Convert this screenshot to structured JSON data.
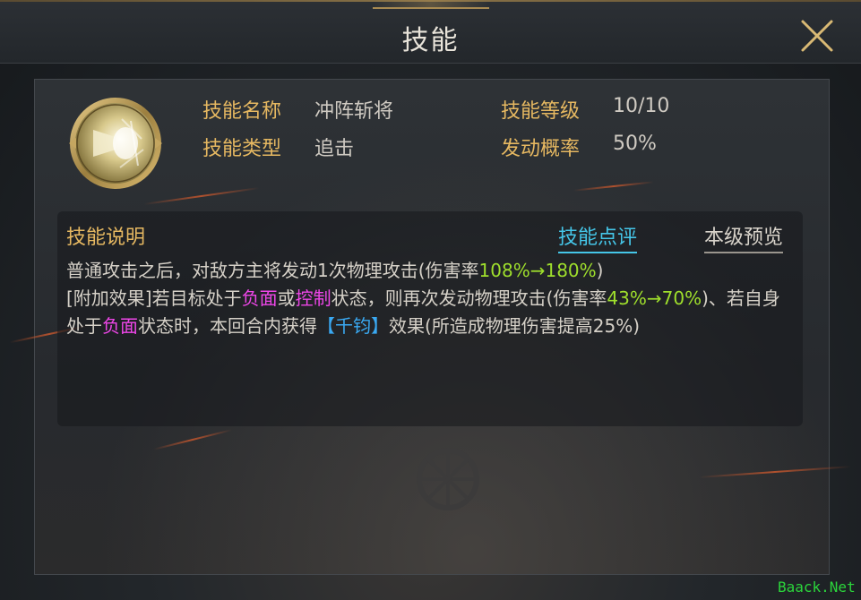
{
  "header": {
    "title": "技能",
    "close_icon": "close-x-icon"
  },
  "skill_info": {
    "icon": "skill-emblem-icon",
    "name_label": "技能名称",
    "name_value": "冲阵斩将",
    "level_label": "技能等级",
    "level_value": "10/10",
    "type_label": "技能类型",
    "type_value": "追击",
    "chance_label": "发动概率",
    "chance_value": "50%"
  },
  "description": {
    "header": "技能说明",
    "tab_review": "技能点评",
    "tab_preview": "本级预览",
    "line1_a": "普通攻击之后，对敌方主将发动1次物理攻击(伤害率",
    "line1_b": "108%→180%",
    "line1_c": ")",
    "line2_a": "[附加效果]若目标处于",
    "line2_b": "负面",
    "line2_c": "或",
    "line2_d": "控制",
    "line2_e": "状态，则再次发动物理攻击(伤害率",
    "line2_f": "43%→70%",
    "line2_g": ")、若自身处于",
    "line2_h": "负面",
    "line2_i": "状态时，本回合内获得",
    "line2_j": "【千钧】",
    "line2_k": "效果(所造成物理伤害提高25%)"
  },
  "watermark": "Baack.Net",
  "colors": {
    "label_gold": "#e6b861",
    "highlight_green": "#9fdf2c",
    "highlight_magenta": "#ee46e8",
    "highlight_blue": "#3aa9f2",
    "tab_active": "#45c6e8"
  }
}
